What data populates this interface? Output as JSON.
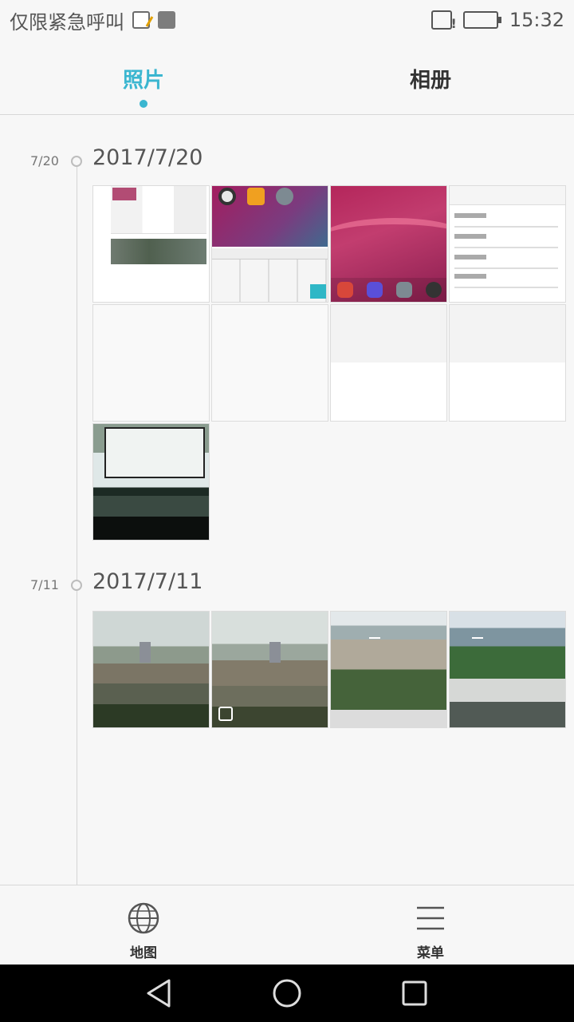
{
  "status_bar": {
    "carrier": "仅限紧急呼叫",
    "time": "15:32"
  },
  "tabs": [
    {
      "label": "照片",
      "active": true
    },
    {
      "label": "相册",
      "active": false
    }
  ],
  "groups": [
    {
      "short_date": "7/20",
      "full_date": "2017/7/20",
      "photo_count": 9
    },
    {
      "short_date": "7/11",
      "full_date": "2017/7/11",
      "photo_count": 4
    }
  ],
  "bottom_actions": [
    {
      "label": "地图",
      "icon": "globe-icon"
    },
    {
      "label": "菜单",
      "icon": "menu-icon"
    }
  ],
  "colors": {
    "accent": "#3bb6d0",
    "background": "#f7f7f7",
    "nav_bar": "#000000"
  }
}
